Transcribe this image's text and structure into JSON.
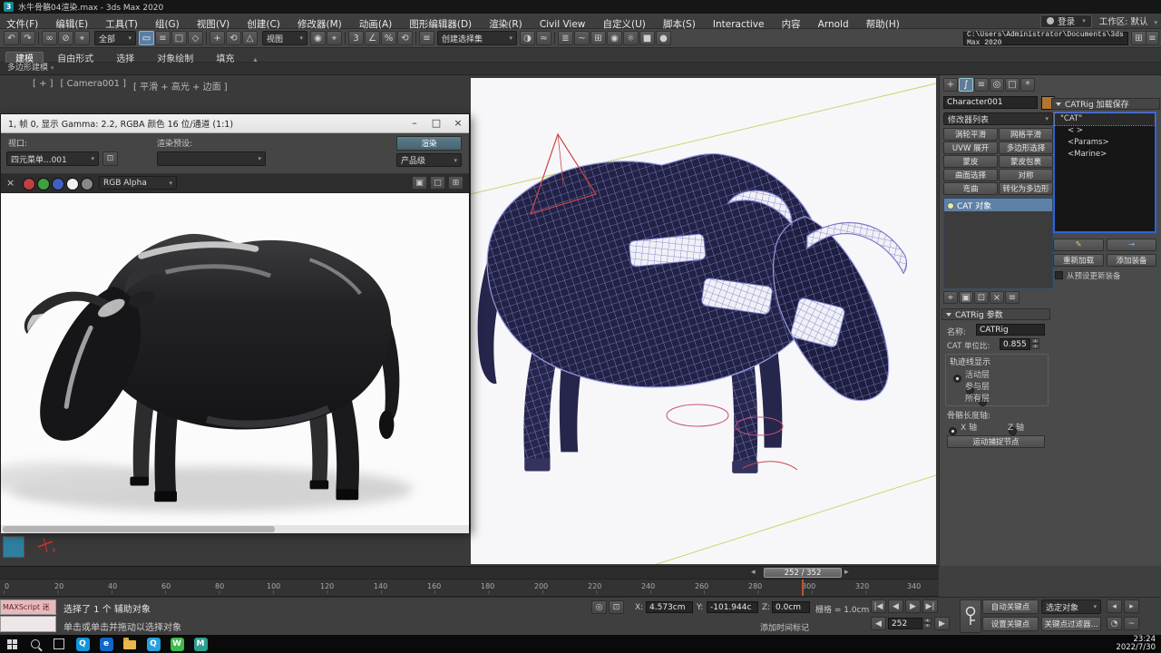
{
  "window": {
    "title": "水牛骨骼04渲染.max - 3ds Max 2020"
  },
  "menu": {
    "items": [
      "文件(F)",
      "编辑(E)",
      "工具(T)",
      "组(G)",
      "视图(V)",
      "创建(C)",
      "修改器(M)",
      "动画(A)",
      "图形编辑器(D)",
      "渲染(R)",
      "Civil View",
      "自定义(U)",
      "脚本(S)",
      "Interactive",
      "内容",
      "Arnold",
      "帮助(H)"
    ],
    "sign_in": "登录",
    "workspace_label": "工作区:",
    "workspace_value": "默认"
  },
  "toolbar": {
    "selection_filter": "全部",
    "ref_coord": "视图",
    "named_sets": "创建选择集",
    "project_path": "C:\\Users\\Administrator\\Documents\\3ds Max 2020 "
  },
  "ribbon": {
    "tabs": [
      "建模",
      "自由形式",
      "选择",
      "对象绘制",
      "填充"
    ],
    "panel_label": "多边形建模"
  },
  "viewport": {
    "label_menu": "[ + ]",
    "label_camera": "[ Camera001 ]",
    "label_shading": "[ 平滑 + 高光 + 边面 ]"
  },
  "render_window": {
    "title": "1, 帧 0, 显示 Gamma: 2.2, RGBA 颜色 16 位/通道 (1:1)",
    "viewport_label": "视口:",
    "viewport_value": "四元菜单...001",
    "preset_label": "渲染预设:",
    "render_button": "渲染",
    "quality": "产品级",
    "channel": "RGB Alpha"
  },
  "command_panel": {
    "object_name": "Character001",
    "modifier_list": "修改器列表",
    "modifier_buttons": [
      "涡轮平滑",
      "网格平滑",
      "UVW 展开",
      "多边形选择",
      "蒙皮",
      "蒙皮包裹",
      "曲面选择",
      "对称",
      "弯曲",
      "转化为多边形"
    ],
    "stack_selected": "CAT 对象"
  },
  "catrig_save": {
    "title": "CATRig 加载保存",
    "list_items": [
      "\"CAT\"",
      "< >",
      "<Params>",
      "<Marine>"
    ],
    "reload_button": "重新加载",
    "add_button": "添加装备",
    "update_checkbox": "从预设更新装备"
  },
  "catrig_params": {
    "title": "CATRig 参数",
    "name_label": "名称:",
    "name_value": "CATRig",
    "unit_label": "CAT 单位比:",
    "unit_value": "0.855",
    "trajectory_title": "轨迹线显示",
    "trajectory_options": [
      "活动层",
      "参与层",
      "所有层"
    ],
    "bone_axis_label": "骨骼长度轴:",
    "axis_x": "X 轴",
    "axis_z": "Z 轴",
    "capture_button": "运动捕捉节点"
  },
  "timeline": {
    "frame_display": "252 / 352",
    "ticks": [
      "0",
      "20",
      "40",
      "60",
      "80",
      "100",
      "120",
      "140",
      "160",
      "180",
      "200",
      "220",
      "240",
      "260",
      "280",
      "300",
      "320",
      "340"
    ]
  },
  "status": {
    "maxscript": "MAXScript 迷",
    "selection": "选择了 1 个 辅助对象",
    "prompt": "单击或单击并拖动以选择对象",
    "x_label": "X:",
    "x_value": "4.573cm",
    "y_label": "Y:",
    "y_value": "-101.944c",
    "z_label": "Z:",
    "z_value": "0.0cm",
    "grid": "栅格 = 1.0cm",
    "time_tag": "添加时间标记",
    "frame_field": "252",
    "auto_key": "自动关键点",
    "set_key": "设置关键点",
    "selected_filter": "选定对象",
    "key_filters": "关键点过滤器..."
  },
  "taskbar": {
    "time": "23:24",
    "date": "2022/7/30"
  }
}
